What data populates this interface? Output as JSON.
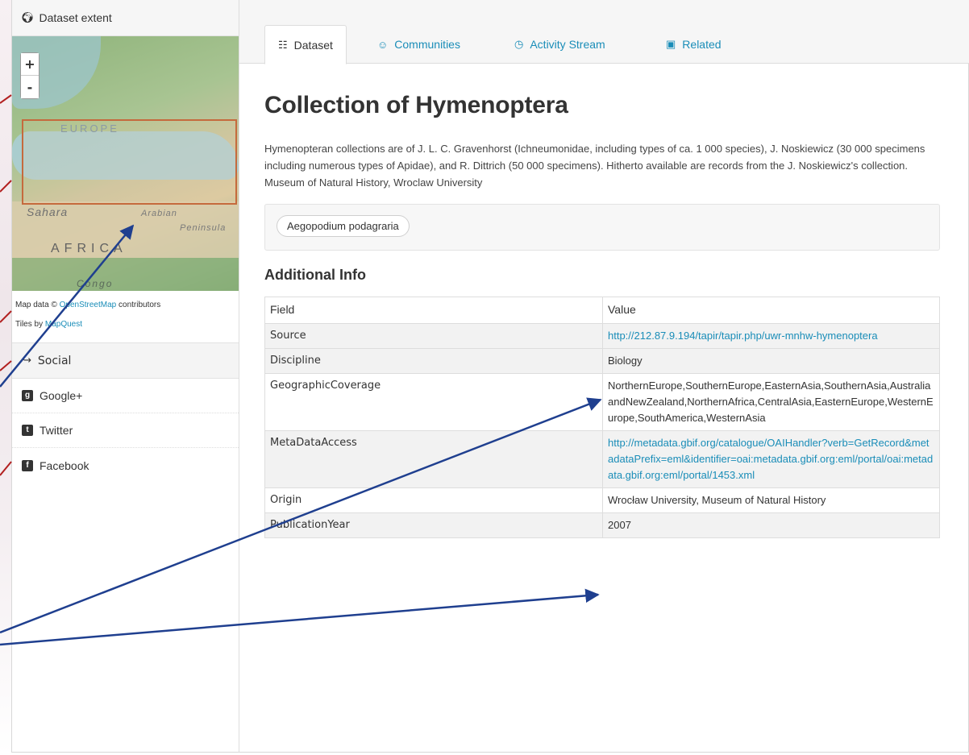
{
  "sidebar": {
    "extent_title": "Dataset extent",
    "map": {
      "zoom_in": "+",
      "zoom_out": "-",
      "labels": {
        "europe": "EUROPE",
        "sahara": "Sahara",
        "arabian": "Arabian",
        "peninsula": "Peninsula",
        "africa": "AFRICA",
        "congo": "Congo"
      }
    },
    "attribution": {
      "map_data_prefix": "Map data ©",
      "osm_link": "OpenStreetMap",
      "contributors": "contributors",
      "tiles_prefix": "Tiles by",
      "mapquest_link": "MapQuest"
    },
    "social": {
      "title": "Social",
      "items": [
        {
          "label": "Google+",
          "icon": "google-plus-icon"
        },
        {
          "label": "Twitter",
          "icon": "twitter-icon"
        },
        {
          "label": "Facebook",
          "icon": "facebook-icon"
        }
      ]
    }
  },
  "tabs": [
    {
      "label": "Dataset",
      "icon": "sitemap-icon",
      "active": true
    },
    {
      "label": "Communities",
      "icon": "group-icon",
      "active": false
    },
    {
      "label": "Activity Stream",
      "icon": "clock-icon",
      "active": false
    },
    {
      "label": "Related",
      "icon": "picture-icon",
      "active": false
    }
  ],
  "dataset": {
    "title": "Collection of Hymenoptera",
    "description": "Hymenopteran collections are of J. L. C. Gravenhorst (Ichneumonidae, including types of ca. 1 000 species), J. Noskiewicz (30 000 specimens including numerous types of Apidae), and R. Dittrich (50 000 specimens). Hitherto available are records from the J. Noskiewicz's collection. Museum of Natural History, Wroclaw University",
    "tags": [
      "Aegopodium podagraria"
    ]
  },
  "additional_info": {
    "heading": "Additional Info",
    "col_field": "Field",
    "col_value": "Value",
    "rows": [
      {
        "field": "Source",
        "value": "http://212.87.9.194/tapir/tapir.php/uwr-mnhw-hymenoptera"
      },
      {
        "field": "Discipline",
        "value": "Biology"
      },
      {
        "field": "GeographicCoverage",
        "value": "NorthernEurope,SouthernEurope,EasternAsia,SouthernAsia,AustraliaandNewZealand,NorthernAfrica,CentralAsia,EasternEurope,WesternEurope,SouthAmerica,WesternAsia"
      },
      {
        "field": "MetaDataAccess",
        "value": "http://metadata.gbif.org/catalogue/OAIHandler?verb=GetRecord&metadataPrefix=eml&identifier=oai:metadata.gbif.org:eml/portal/oai:metadata.gbif.org:eml/portal/1453.xml"
      },
      {
        "field": "Origin",
        "value": "Wrocław University, Museum of Natural History"
      },
      {
        "field": "PublicationYear",
        "value": "2007"
      }
    ]
  },
  "colors": {
    "link": "#1a8db8",
    "arrow": "#1f3f8f",
    "annotation_red": "#b22020",
    "extent_box": "#c56a3d"
  }
}
